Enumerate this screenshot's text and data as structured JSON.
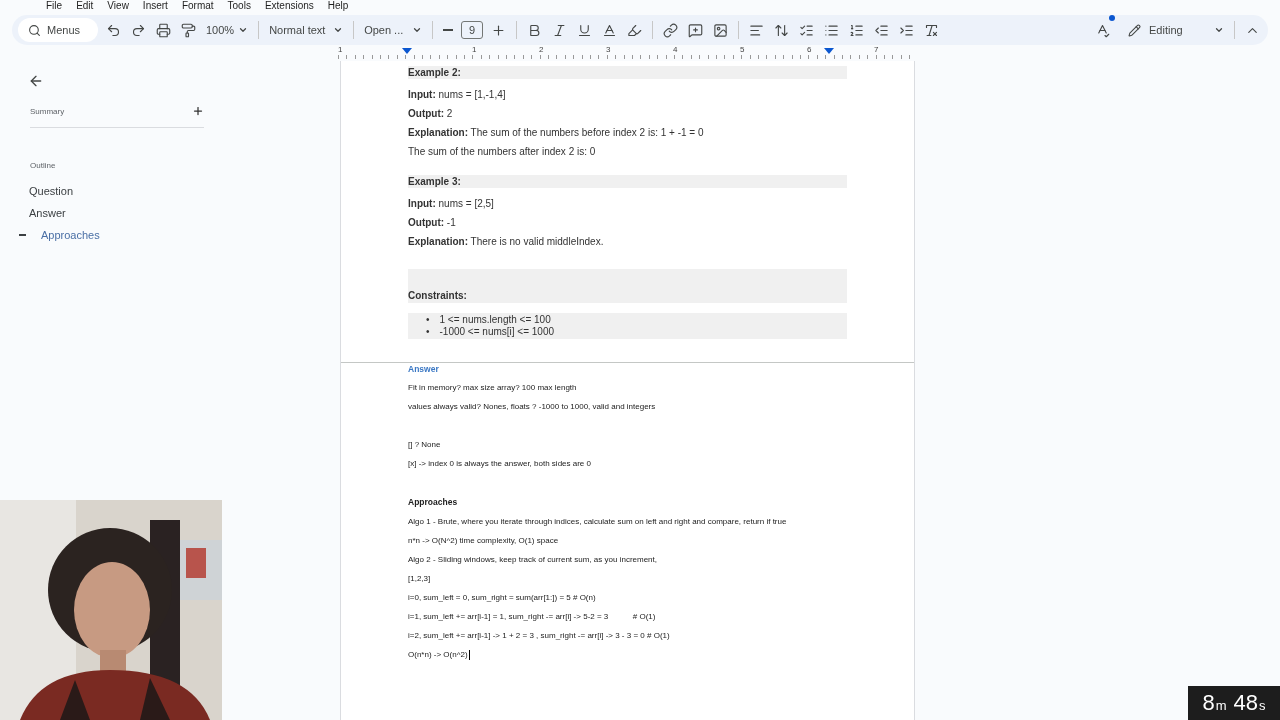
{
  "menu_bar": [
    "File",
    "Edit",
    "View",
    "Insert",
    "Format",
    "Tools",
    "Extensions",
    "Help"
  ],
  "toolbar": {
    "search": {
      "placeholder": "Menus"
    },
    "zoom": "100%",
    "style": "Normal text",
    "font": "Open ...",
    "font_size": "9",
    "mode": "Editing"
  },
  "ruler": {
    "labels": [
      "1",
      "1",
      "2",
      "3",
      "4",
      "5",
      "6",
      "7"
    ]
  },
  "sidebar": {
    "summary_label": "Summary",
    "outline_label": "Outline",
    "outline": [
      {
        "label": "Question",
        "selected": false
      },
      {
        "label": "Answer",
        "selected": false,
        "children": [
          {
            "label": "Approaches",
            "selected": true
          }
        ]
      }
    ]
  },
  "document": {
    "pages": [
      {
        "blocks": [
          {
            "kind": "heading",
            "text": "Example 2:"
          },
          {
            "kind": "para",
            "text": "**Input:** nums = [1,-1,4]"
          },
          {
            "kind": "para",
            "text": "**Output:** 2"
          },
          {
            "kind": "para",
            "text": "**Explanation:** The sum of the numbers before index 2 is: 1 + -1 = 0"
          },
          {
            "kind": "para",
            "text": "The sum of the numbers after index 2 is: 0"
          },
          {
            "kind": "gap"
          },
          {
            "kind": "heading",
            "text": "Example 3:"
          },
          {
            "kind": "para",
            "text": "**Input:** nums = [2,5]"
          },
          {
            "kind": "para",
            "text": "**Output:** -1"
          },
          {
            "kind": "para",
            "text": "**Explanation:** There is no valid middleIndex."
          },
          {
            "kind": "gap"
          },
          {
            "kind": "constraints",
            "text": "Constraints:"
          },
          {
            "kind": "bullets",
            "items": [
              {
                "marker": "•",
                "text": "1 <= nums.length <= 100"
              },
              {
                "marker": "•",
                "text": "-1000 <= nums[i] <= 1000"
              }
            ]
          }
        ]
      },
      {
        "blocks": [
          {
            "kind": "title",
            "text": "Answer"
          },
          {
            "kind": "note",
            "text": "Fit in memory? max size array? 100 max length"
          },
          {
            "kind": "note",
            "text": "values always valid? Nones, floats ? -1000 to 1000, valid and integers"
          },
          {
            "kind": "blank"
          },
          {
            "kind": "note",
            "text": "[] ? None"
          },
          {
            "kind": "note",
            "text": "[x] -> index 0 is always the answer, both sides are 0"
          },
          {
            "kind": "blank"
          },
          {
            "kind": "subhead",
            "text": "Approaches"
          },
          {
            "kind": "note",
            "text": "Algo 1 - Brute, where you iterate through indices, calculate sum on left and right and compare, return if true"
          },
          {
            "kind": "note",
            "text": "n*n -> O(N^2) time complexity, O(1) space"
          },
          {
            "kind": "note",
            "text": "Algo 2 - Sliding windows, keep track of current sum, as you increment,"
          },
          {
            "kind": "note",
            "text": "[1,2,3]"
          },
          {
            "kind": "note",
            "text": "i=0, sum_left = 0, sum_right = sum(arr[1:]) = 5 # O(n)"
          },
          {
            "kind": "note",
            "text": "i=1, sum_left += arr[i-1] = 1, sum_right -= arr[i] -> 5-2 = 3           # O(1)"
          },
          {
            "kind": "note",
            "text": "i=2, sum_left += arr[i-1] -> 1 + 2 = 3 , sum_right -= arr[i] -> 3 - 3 = 0 # O(1)"
          },
          {
            "kind": "note",
            "text": "O(n*n) -> O(n^2)",
            "cursor": true
          }
        ]
      }
    ]
  },
  "timer": {
    "minutes": "8",
    "minutes_unit": "m",
    "seconds": "48",
    "seconds_unit": "s"
  }
}
